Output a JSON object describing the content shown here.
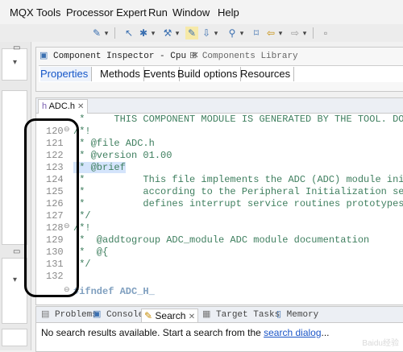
{
  "menu": [
    "MQX Tools",
    "Processor Expert",
    "Run",
    "Window",
    "Help"
  ],
  "inspector": {
    "tab_title": "Component Inspector - Cpu",
    "tab2_title": "Components Library",
    "prop_tabs": [
      "Properties",
      "Methods",
      "Events",
      "Build options",
      "Resources"
    ]
  },
  "editor": {
    "tab_title": "ADC.h",
    "lines": [
      {
        "num": "",
        "text": " *     THIS COMPONENT MODULE IS GENERATED BY THE TOOL. DO NOT MODIFY IT."
      },
      {
        "num": "120",
        "text": "/*!"
      },
      {
        "num": "121",
        "text": " * @file ADC.h"
      },
      {
        "num": "122",
        "text": " * @version 01.00"
      },
      {
        "num": "123",
        "text": " * @brief"
      },
      {
        "num": "124",
        "text": " *          This file implements the ADC (ADC) module initialization"
      },
      {
        "num": "125",
        "text": " *          according to the Peripheral Initialization settings, and"
      },
      {
        "num": "126",
        "text": " *          defines interrupt service routines prototypes."
      },
      {
        "num": "127",
        "text": " */"
      },
      {
        "num": "128",
        "text": "/*!"
      },
      {
        "num": "129",
        "text": " *  @addtogroup ADC_module ADC module documentation"
      },
      {
        "num": "130",
        "text": " *  @{"
      },
      {
        "num": "131",
        "text": " */"
      },
      {
        "num": "132",
        "text": ""
      },
      {
        "num": "",
        "text": "#ifndef ADC_H_"
      }
    ]
  },
  "bottom": {
    "tabs": [
      "Problems",
      "Console",
      "Search",
      "Target Tasks",
      "Memory"
    ],
    "message": "No search results available. Start a search from the ",
    "link": "search dialog",
    "ellipsis": "..."
  },
  "watermark": "Baidu经验",
  "colors": {
    "comment": "#3f7f5f",
    "accent": "#1456c8",
    "highlight": "#d4e4fb"
  }
}
